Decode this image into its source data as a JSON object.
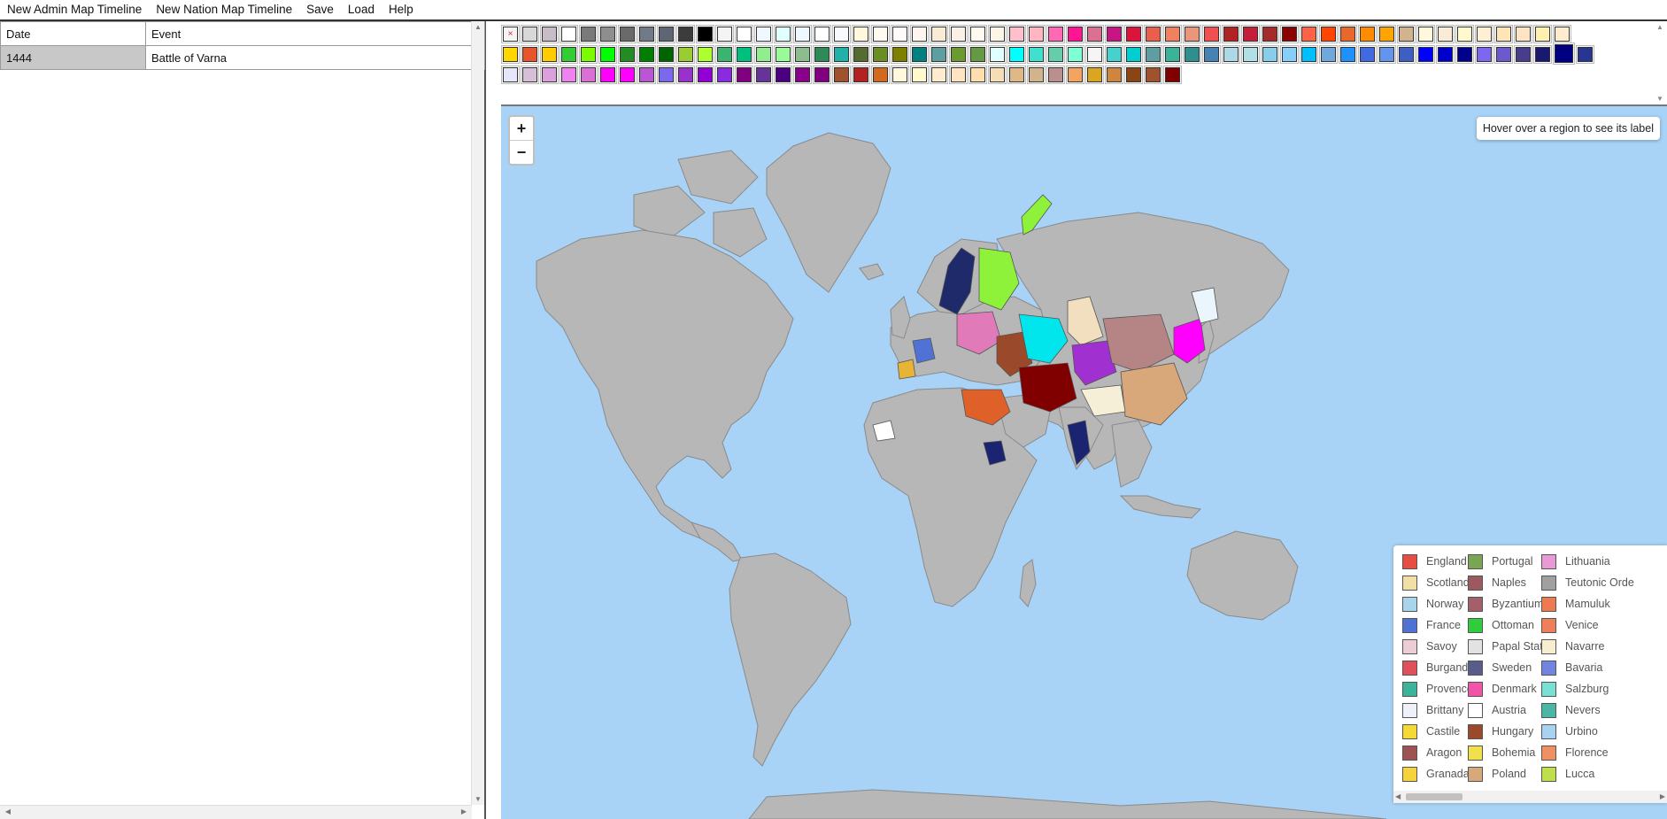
{
  "menu": {
    "items": [
      "New Admin Map Timeline",
      "New Nation Map Timeline",
      "Save",
      "Load",
      "Help"
    ]
  },
  "timeline": {
    "headers": {
      "date": "Date",
      "event": "Event"
    },
    "rows": [
      {
        "date": "1444",
        "event": "Battle of Varna"
      }
    ]
  },
  "palette": {
    "clear_symbol": "×",
    "rows": [
      [
        "#d8d8d8",
        "#c8bcc8",
        "#ffffff",
        "#7a7a7a",
        "#8e8e8e",
        "#6a6a6a",
        "#707a88",
        "#5d6672",
        "#3c3c3c",
        "#000000",
        "#f4f4f4",
        "#ffffff",
        "#f0f8ff",
        "#e0ffff",
        "#f0f8ff",
        "#ffffff",
        "#f8f8ff",
        "#fff8dc",
        "#fffaf0",
        "#fffafa",
        "#fff5ee",
        "#faebd7",
        "#faf0e6",
        "#fffaf0",
        "#fdf5e6",
        "#ffc0cb",
        "#ffb6c1",
        "#ff69b4",
        "#ff1493",
        "#db7093",
        "#c71585",
        "#dc143c",
        "#e8604c",
        "#f08060",
        "#e9967a",
        "#f05050",
        "#b22222",
        "#c41e3a",
        "#a52a2a",
        "#8b0000",
        "#ff6347",
        "#ff4500",
        "#e8672a",
        "#ff8c00",
        "#ffa500",
        "#d2b48c",
        "#fff8dc",
        "#faebd7",
        "#fffacd",
        "#ffefd5",
        "#ffe4b5",
        "#ffe4c4",
        "#fff0b0",
        "#ffebcd"
      ],
      [
        "#ffd700",
        "#e8552a",
        "#ffcc00",
        "#32cd32",
        "#7cfc00",
        "#00ff00",
        "#228b22",
        "#008000",
        "#006400",
        "#9acd32",
        "#adff2f",
        "#3cb371",
        "#00c080",
        "#90ee90",
        "#98fb98",
        "#8fbc8f",
        "#2e8b57",
        "#20b2aa",
        "#556b2f",
        "#6b8e23",
        "#808000",
        "#008080",
        "#5f9ea0",
        "#6a9a30",
        "#669944",
        "#e0ffff",
        "#00ffff",
        "#40e0d0",
        "#66cdaa",
        "#7fffd4",
        "#f5f5f5",
        "#48d1cc",
        "#00ced1",
        "#5f9ea0",
        "#3cb399",
        "#2f8f8f",
        "#4682b4",
        "#add8e6",
        "#b0e0e6",
        "#87ceeb",
        "#87cefa",
        "#00bfff",
        "#6fa8dc",
        "#1e90ff",
        "#4169e1",
        "#6495ed",
        "#3d5fc4",
        "#0000ff",
        "#0000cd",
        "#00008b",
        "#7b68ee",
        "#6a5acd",
        "#483d8b",
        "#191970",
        "#000080",
        "#283593"
      ],
      [
        "#e6e6fa",
        "#d8bfd8",
        "#dda0dd",
        "#ee82ee",
        "#da70d6",
        "#ff00ff",
        "#ff00ff",
        "#ba55d3",
        "#7b68ee",
        "#9932cc",
        "#9400d3",
        "#8a2be2",
        "#800080",
        "#663399",
        "#4b0082",
        "#8b008b",
        "#800080",
        "#a0522d",
        "#b22222",
        "#d2691e",
        "#fff8dc",
        "#fffacd",
        "#ffebcd",
        "#ffe4c4",
        "#ffdead",
        "#f5deb3",
        "#deb887",
        "#d2b48c",
        "#bc8f8f",
        "#f4a460",
        "#daa520",
        "#cd853f",
        "#8b4513",
        "#a0522d",
        "#800000"
      ]
    ]
  },
  "map": {
    "zoom_in": "+",
    "zoom_out": "−",
    "hover_hint": "Hover over a region to see its label",
    "ocean_color": "#a8d3f6",
    "land_color": "#b7b7b7"
  },
  "legend": {
    "columns": [
      [
        {
          "name": "England",
          "color": "#e84d42"
        },
        {
          "name": "Scotland",
          "color": "#f2dfa6"
        },
        {
          "name": "Norway",
          "color": "#a9d5ec"
        },
        {
          "name": "France",
          "color": "#4f72d4"
        },
        {
          "name": "Savoy",
          "color": "#eccdd6"
        },
        {
          "name": "Burgandy",
          "color": "#e0505a"
        },
        {
          "name": "Provence",
          "color": "#3cb39b"
        },
        {
          "name": "Brittany",
          "color": "#eef0fa"
        },
        {
          "name": "Castile",
          "color": "#f5d935"
        },
        {
          "name": "Aragon",
          "color": "#9e5252"
        },
        {
          "name": "Granada",
          "color": "#f6d33a"
        }
      ],
      [
        {
          "name": "Portugal",
          "color": "#7aa653"
        },
        {
          "name": "Naples",
          "color": "#9c5a60"
        },
        {
          "name": "Byzantium",
          "color": "#a35f6a"
        },
        {
          "name": "Ottoman",
          "color": "#2fcc3c"
        },
        {
          "name": "Papal State",
          "color": "#e2e2e2"
        },
        {
          "name": "Sweden",
          "color": "#585c8a"
        },
        {
          "name": "Denmark",
          "color": "#f254a8"
        },
        {
          "name": "Austria",
          "color": "#ffffff"
        },
        {
          "name": "Hungary",
          "color": "#9a4a2a"
        },
        {
          "name": "Bohemia",
          "color": "#f2e04a"
        },
        {
          "name": "Poland",
          "color": "#d9a87a"
        }
      ],
      [
        {
          "name": "Lithuania",
          "color": "#e99ad4"
        },
        {
          "name": "Teutonic Orde",
          "color": "#a0a0a0"
        },
        {
          "name": "Mamuluk",
          "color": "#ee7a50"
        },
        {
          "name": "Venice",
          "color": "#ef7e5a"
        },
        {
          "name": "Navarre",
          "color": "#f7edcf"
        },
        {
          "name": "Bavaria",
          "color": "#6f85e0"
        },
        {
          "name": "Salzburg",
          "color": "#78e0d4"
        },
        {
          "name": "Nevers",
          "color": "#48b8a4"
        },
        {
          "name": "Urbino",
          "color": "#a8d2f2"
        },
        {
          "name": "Florence",
          "color": "#f09060"
        },
        {
          "name": "Lucca",
          "color": "#bede4a"
        }
      ]
    ]
  }
}
